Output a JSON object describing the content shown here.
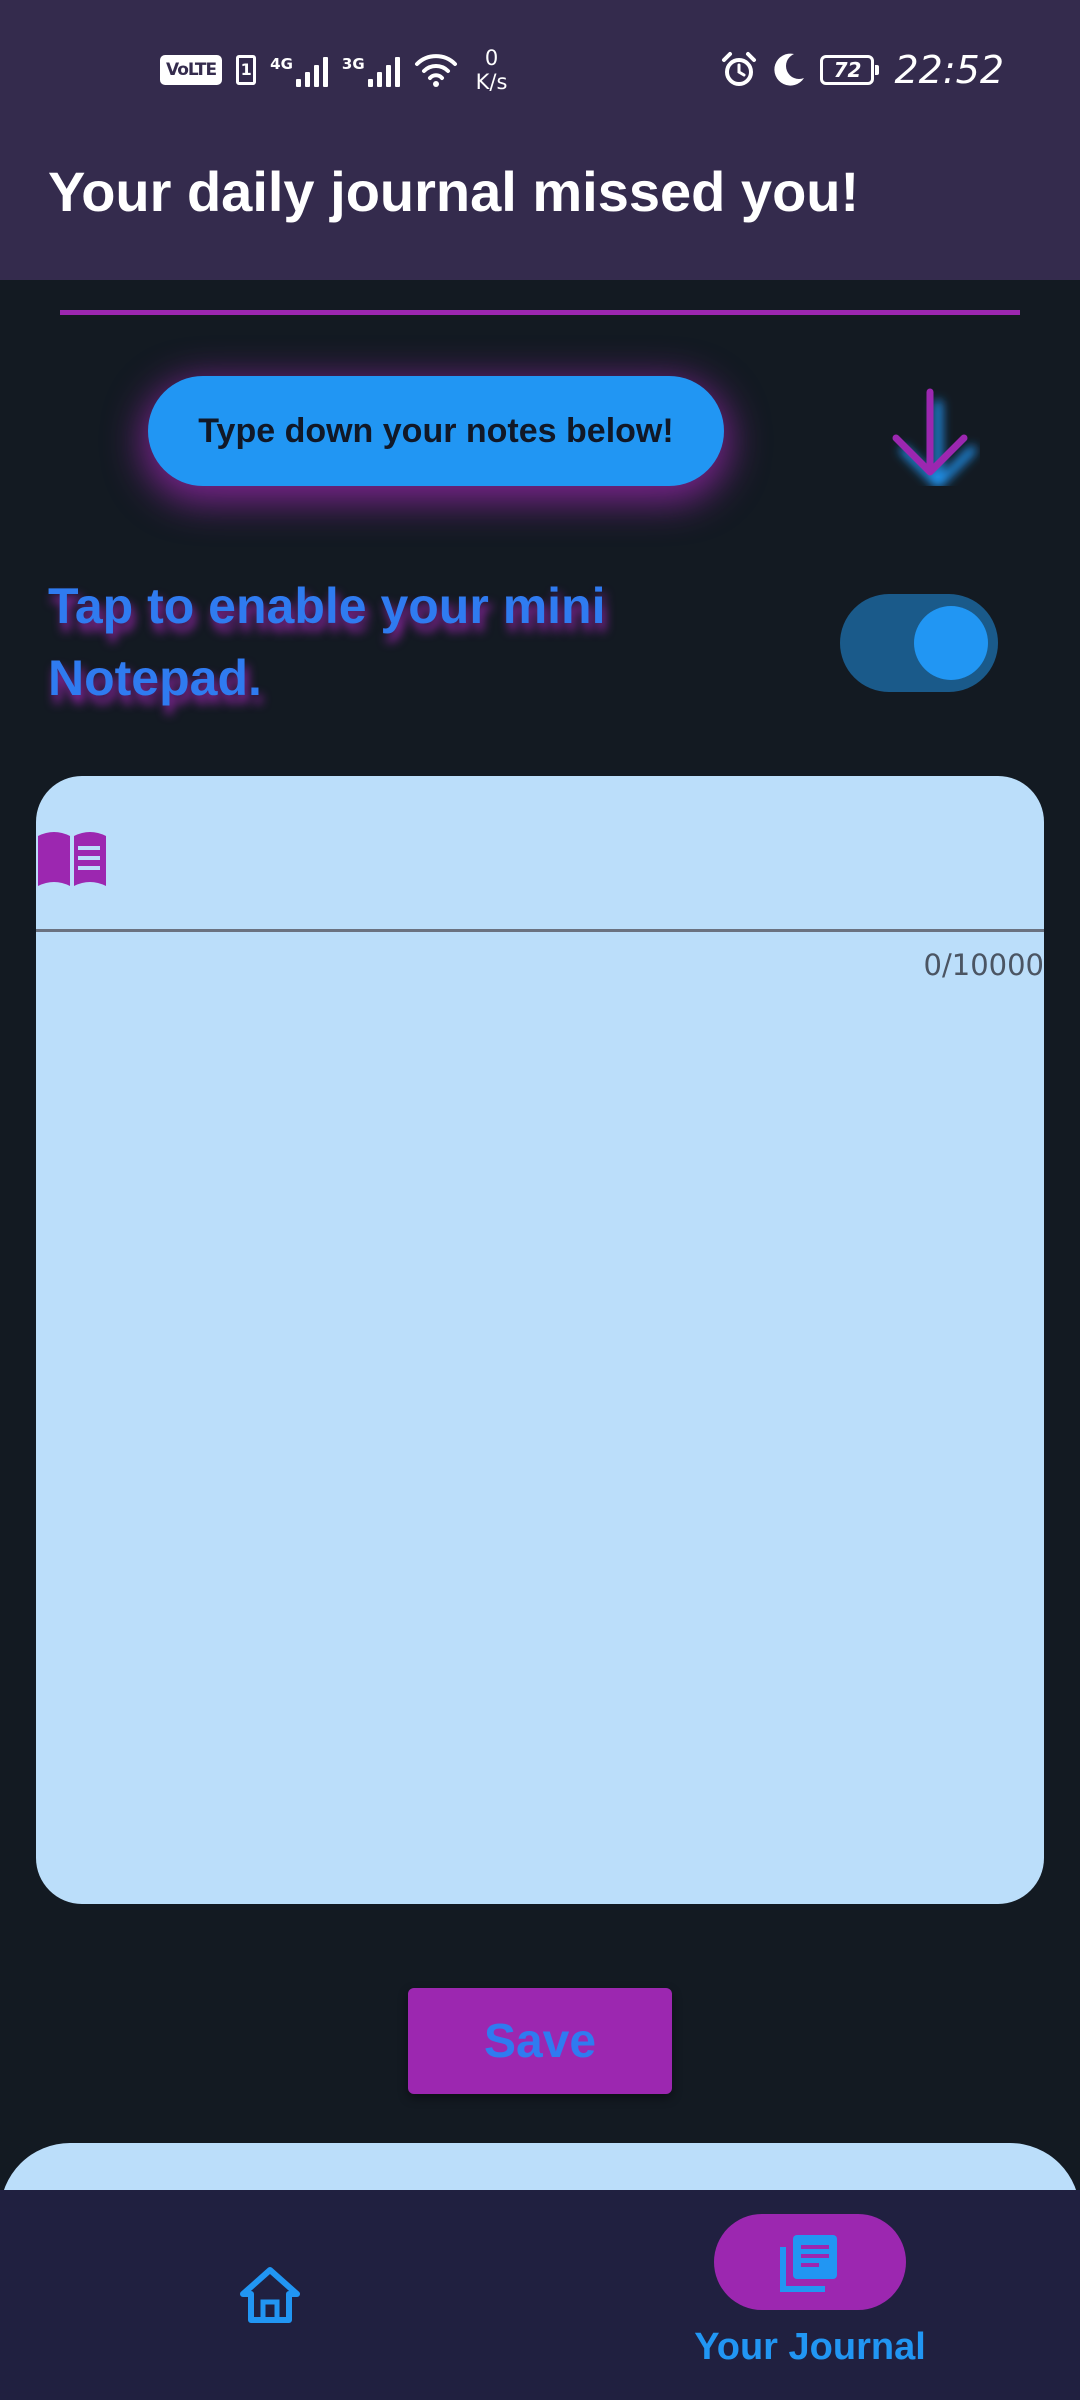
{
  "status_bar": {
    "volte": "VoLTE",
    "sim": "1",
    "network_1": "4G",
    "network_2": "3G",
    "speed_value": "0",
    "speed_unit": "K/s",
    "battery": "72",
    "time": "22:52"
  },
  "header": {
    "title": "Your daily journal missed you!"
  },
  "prompt": {
    "pill_text": "Type down your notes below!"
  },
  "toggle": {
    "label": "Tap to enable your mini Notepad.",
    "enabled": true
  },
  "note": {
    "value": "",
    "counter": "0/10000"
  },
  "actions": {
    "save_label": "Save"
  },
  "nav": {
    "home_icon": "home-icon",
    "journal_icon": "journal-icon",
    "journal_label": "Your Journal",
    "active": "journal"
  },
  "colors": {
    "header_bg": "#342b4d",
    "background": "#131a22",
    "accent_purple": "#9c27b0",
    "accent_blue": "#2196f3",
    "card_bg": "#bbdefa",
    "nav_bg": "#202040"
  }
}
